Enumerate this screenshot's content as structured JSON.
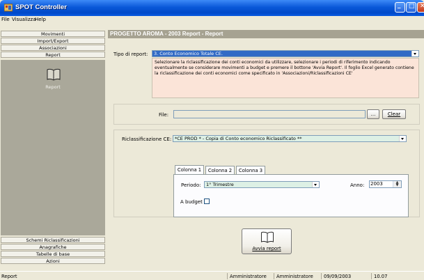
{
  "window": {
    "title": "SPOT Controller"
  },
  "menu": [
    "File",
    "Visualizza",
    "Help"
  ],
  "sidebar": {
    "top_items": [
      "Movimenti",
      "Import/Export",
      "Associazioni",
      "Report"
    ],
    "active_label": "Report",
    "bottom_items": [
      "Schemi Riclassificazioni",
      "Anagrafiche",
      "Tabelle di base",
      "Azioni"
    ]
  },
  "header": {
    "title": "PROGETTO AROMA - 2003  Report - Report"
  },
  "report_type": {
    "label": "Tipo di report:",
    "value": "3. Conto Economico Totale CE."
  },
  "description": "Selezionare la riclassificazione dei conti economici da utilizzare, selezionare i periodi di riferimento indicando eventualmente se considerare movimenti a budget e premere il bottone 'Avvia Report'. Il foglio Excel generato contiene la riclassificazione dei conti economici come specificato in 'Associazioni/Riclassificazioni CE'",
  "file": {
    "label": "File:",
    "value": "",
    "browse_label": "...",
    "clear_label": "Clear"
  },
  "riclassificazione": {
    "label": "Riclassificazione CE:",
    "value": "*CE PROD * - Copia di Conto economico Riclassificato **"
  },
  "tabs": [
    {
      "label": "Colonna 1"
    },
    {
      "label": "Colonna 2"
    },
    {
      "label": "Colonna 3"
    }
  ],
  "column": {
    "periodo_label": "Periodo:",
    "periodo_value": "1° Trimestre",
    "anno_label": "Anno:",
    "anno_value": "2003",
    "budget_label": "A budget"
  },
  "run_button": {
    "label": "Avvia report"
  },
  "statusbar": {
    "left": "Report",
    "user1": "Amministratore",
    "user2": "Amministratore",
    "date": "09/09/2003",
    "time": "10.07"
  },
  "icons": [
    "app-icon",
    "book-icon",
    "minimize-icon",
    "maximize-icon",
    "close-icon",
    "dropdown-arrow-icon"
  ]
}
